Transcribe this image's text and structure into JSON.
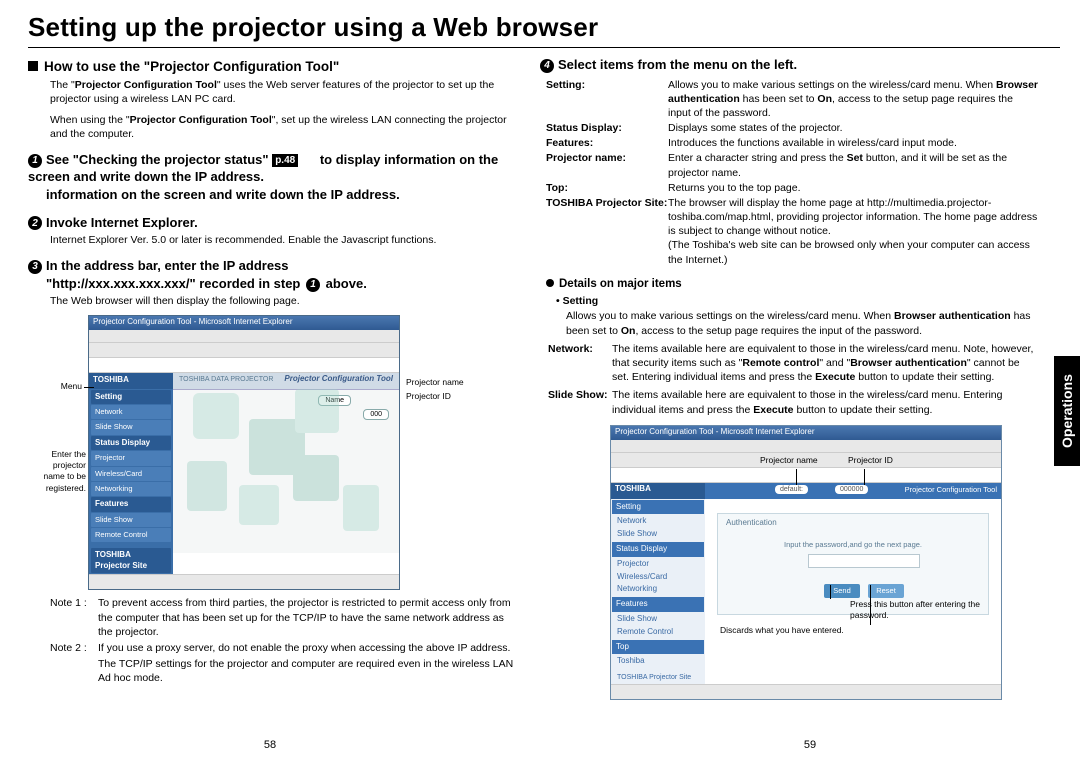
{
  "title": "Setting up the projector using a Web browser",
  "side_tab": "Operations",
  "page_left": "58",
  "page_right": "59",
  "left": {
    "h1": "How to use the \"Projector Configuration Tool\"",
    "p1a": "The \"",
    "p1b": "Projector Configuration Tool",
    "p1c": "\" uses the Web server features of the projector to set up the projector using a wireless LAN PC card.",
    "p2a": "When using the \"",
    "p2b": "Projector Configuration Tool",
    "p2c": "\", set up the wireless LAN connecting the projector and the computer.",
    "step1a": "See \"Checking the projector status\"",
    "step1_ref": "p.48",
    "step1b": "to display information on the screen and write down the IP address.",
    "step2": "Invoke Internet Explorer.",
    "step2_p": "Internet Explorer Ver. 5.0 or later is recommended. Enable the Javascript functions.",
    "step3a": "In the address bar, enter the IP address",
    "step3b": "\"http://xxx.xxx.xxx.xxx/\" recorded in step",
    "step3c": "above.",
    "step3_p": "The Web browser will then display the following page.",
    "shot": {
      "titlebar": "Projector Configuration Tool - Microsoft Internet Explorer",
      "logo": "TOSHIBA",
      "pct": "Projector Configuration Tool",
      "brand": "TOSHIBA DATA PROJECTOR",
      "menu_h1": "Setting",
      "menu_i1": "Network",
      "menu_i1b": "Slide Show",
      "menu_h2": "Status Display",
      "menu_i2a": "Projector",
      "menu_i2b": "Wireless/Card",
      "menu_i2c": "Networking",
      "menu_h3": "Features",
      "menu_i3a": "Slide Show",
      "menu_i3b": "Remote Control",
      "menu_ft": "TOSHIBA Projector Site",
      "chip_name": "Name",
      "chip_id": "000",
      "cl_menu": "Menu",
      "cl_enter": "Enter the projector name to be registered.",
      "cl_pname": "Projector name",
      "cl_pid": "Projector ID"
    },
    "note1_l": "Note 1 :",
    "note1": "To prevent access from third parties, the projector is restricted to permit access only from the computer that has been set up for the TCP/IP to have the same network address as the projector.",
    "note2_l": "Note 2 :",
    "note2": "If you use a proxy server, do not enable the proxy when accessing the above IP address.",
    "note2b": "The TCP/IP settings for the projector and computer are required even in the wireless LAN Ad hoc mode."
  },
  "right": {
    "step4": "Select items from the menu on the left.",
    "defs": [
      {
        "t": "Setting:",
        "v_a": "Allows you to make various settings on the wireless/card menu. When ",
        "v_b": "Browser authentication",
        "v_c": " has been set to ",
        "v_d": "On",
        "v_e": ", access to the setup page requires the input of the password."
      },
      {
        "t": "Status Display:",
        "v": "Displays some states of the projector."
      },
      {
        "t": "Features:",
        "v": "Introduces the functions available in wireless/card input mode."
      },
      {
        "t": "Projector name:",
        "v_a": "Enter a character string and press the ",
        "v_b": "Set",
        "v_c": " button, and it will be set as the projector name."
      },
      {
        "t": "Top:",
        "v": "Returns you to the top page."
      },
      {
        "t": "TOSHIBA Projector Site:",
        "v": "The browser will display the home page at http://multimedia.projector-toshiba.com/map.html, providing projector information. The home page address is subject to change without notice.",
        "v2": "(The Toshiba's web site can be browsed only when your computer can access the Internet.)"
      }
    ],
    "details_h": "Details on major items",
    "b_setting": "• Setting",
    "b_setting_p_a": "Allows you to make various settings on the wireless/card menu. When ",
    "b_setting_p_b": "Browser authentication",
    "b_setting_p_c": " has been set to ",
    "b_setting_p_d": "On",
    "b_setting_p_e": ", access to the setup page requires the input of the password.",
    "det": [
      {
        "t": "Network:",
        "v_a": "The items available here are equivalent to those in the wireless/card menu. Note, however, that security items such as \"",
        "v_b": "Remote control",
        "v_c": "\" and \"",
        "v_d": "Browser authentication",
        "v_e": "\" cannot be set. Entering individual items and press the ",
        "v_f": "Execute",
        "v_g": " button to update their setting."
      },
      {
        "t": "Slide Show:",
        "v_a": "The items available here are equivalent to those in the wireless/card menu. Entering individual items and press the ",
        "v_f": "Execute",
        "v_g": " button to update their setting."
      }
    ],
    "shot": {
      "titlebar": "Projector Configuration Tool - Microsoft Internet Explorer",
      "logo": "TOSHIBA",
      "top_pct": "Projector Configuration Tool",
      "top_name": "default:",
      "top_id": "000000",
      "s_h1": "Setting",
      "s_i1": "Network",
      "s_i1b": "Slide Show",
      "s_h2": "Status Display",
      "s_i2a": "Projector",
      "s_i2b": "Wireless/Card",
      "s_i2c": "Networking",
      "s_h3": "Features",
      "s_i3a": "Slide Show",
      "s_i3b": "Remote Control",
      "s_h4": "Top",
      "s_i4a": "Toshiba",
      "s_ft": "TOSHIBA Projector Site",
      "auth": "Authentication",
      "auth_msg": "Input the password,and go the next page.",
      "btn_send": "Send",
      "btn_reset": "Reset",
      "ann_pname": "Projector name",
      "ann_pid": "Projector ID",
      "ann_press": "Press this button after entering the password.",
      "ann_discard": "Discards what you have entered."
    }
  }
}
